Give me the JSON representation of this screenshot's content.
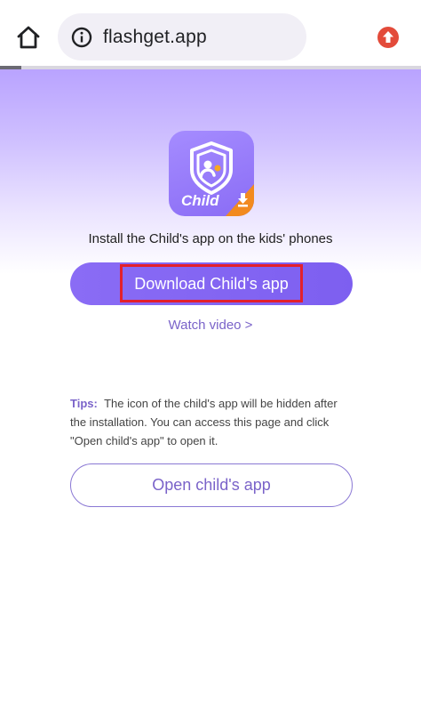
{
  "browser": {
    "url": "flashget.app",
    "tab_progress_fraction": 0.05
  },
  "hero": {
    "app_icon_text": "Child",
    "install_text": "Install the Child's app on the kids' phones"
  },
  "actions": {
    "download_label": "Download Child's app",
    "watch_video_label": "Watch video >",
    "open_label": "Open child's app"
  },
  "tips": {
    "label": "Tips:",
    "text": "The icon of the child's app will be hidden after the installation. You can access this page and click \"Open child's app\" to open it."
  },
  "colors": {
    "accent": "#8a6cf5",
    "link": "#7a63c9",
    "highlight": "#e3202c",
    "upload_icon": "#e34b3a"
  },
  "icons": {
    "home": "home-icon",
    "info": "info-icon",
    "upload": "upload-icon",
    "shield": "shield-icon",
    "download_arrow": "download-arrow-icon"
  }
}
